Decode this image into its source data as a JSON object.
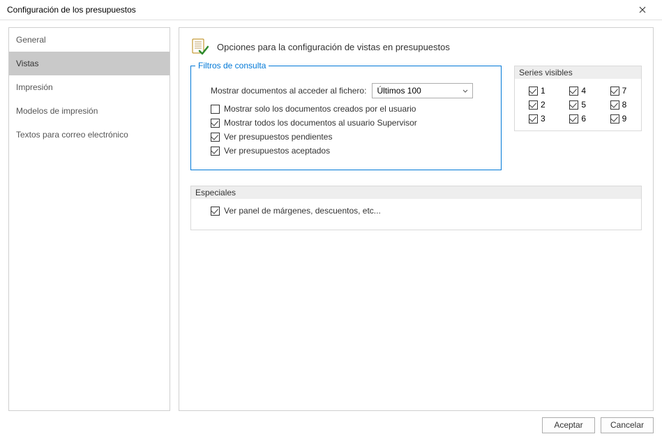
{
  "titlebar": {
    "title": "Configuración de los presupuestos"
  },
  "sidebar": {
    "items": [
      {
        "label": "General"
      },
      {
        "label": "Vistas"
      },
      {
        "label": "Impresión"
      },
      {
        "label": "Modelos de impresión"
      },
      {
        "label": "Textos para correo electrónico"
      }
    ],
    "active_index": 1
  },
  "header": {
    "title": "Opciones para la configuración de vistas en presupuestos"
  },
  "filtros": {
    "group_label": "Filtros de consulta",
    "mostrar_label": "Mostrar documentos al acceder al fichero:",
    "mostrar_select_value": "Últimos 100",
    "checks": [
      {
        "label": "Mostrar solo los documentos creados por el usuario",
        "checked": false
      },
      {
        "label": "Mostrar todos los documentos al usuario Supervisor",
        "checked": true
      },
      {
        "label": "Ver presupuestos pendientes",
        "checked": true
      },
      {
        "label": "Ver presupuestos aceptados",
        "checked": true
      }
    ]
  },
  "series": {
    "group_label": "Series visibles",
    "items": [
      {
        "label": "1",
        "checked": true
      },
      {
        "label": "4",
        "checked": true
      },
      {
        "label": "7",
        "checked": true
      },
      {
        "label": "2",
        "checked": true
      },
      {
        "label": "5",
        "checked": true
      },
      {
        "label": "8",
        "checked": true
      },
      {
        "label": "3",
        "checked": true
      },
      {
        "label": "6",
        "checked": true
      },
      {
        "label": "9",
        "checked": true
      }
    ]
  },
  "especiales": {
    "group_label": "Especiales",
    "checks": [
      {
        "label": "Ver panel de márgenes, descuentos, etc...",
        "checked": true
      }
    ]
  },
  "buttons": {
    "accept": "Aceptar",
    "cancel": "Cancelar"
  }
}
